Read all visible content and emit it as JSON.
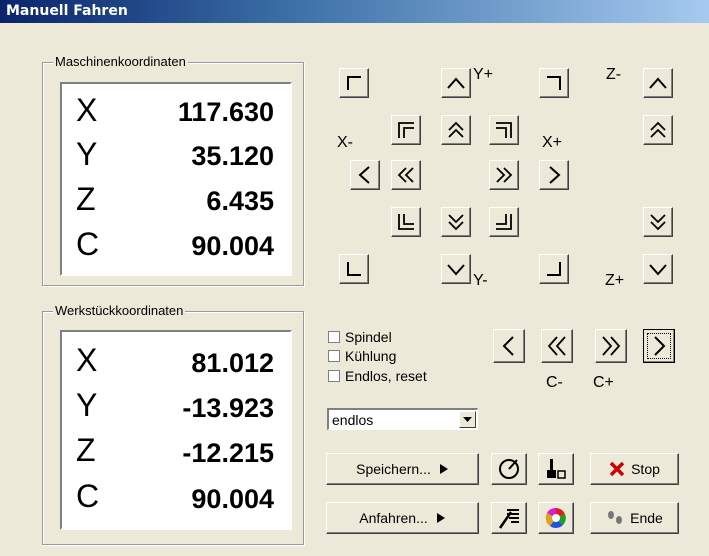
{
  "window": {
    "title": "Manuell Fahren"
  },
  "machine": {
    "legend": "Maschinenkoordinaten",
    "rows": [
      {
        "axis": "X",
        "value": "117.630"
      },
      {
        "axis": "Y",
        "value": "35.120"
      },
      {
        "axis": "Z",
        "value": "6.435"
      },
      {
        "axis": "C",
        "value": "90.004"
      }
    ]
  },
  "workpiece": {
    "legend": "Werkstückkoordinaten",
    "rows": [
      {
        "axis": "X",
        "value": "81.012"
      },
      {
        "axis": "Y",
        "value": "-13.923"
      },
      {
        "axis": "Z",
        "value": "-12.215"
      },
      {
        "axis": "C",
        "value": "90.004"
      }
    ]
  },
  "jog": {
    "y_plus": "Y+",
    "y_minus": "Y-",
    "x_minus": "X-",
    "x_plus": "X+",
    "z_minus": "Z-",
    "z_plus": "Z+",
    "c_minus": "C-",
    "c_plus": "C+"
  },
  "options": {
    "spindel": "Spindel",
    "kuehlung": "Kühlung",
    "endlos": "Endlos, reset",
    "mode_selected": "endlos"
  },
  "buttons": {
    "speichern": "Speichern...",
    "anfahren": "Anfahren...",
    "stop": "Stop",
    "ende": "Ende"
  },
  "icons": {
    "stop": "x-mark-icon",
    "ende": "footsteps-icon"
  },
  "colors": {
    "stop_red": "#cc0000",
    "title_bar": "#0a246a"
  }
}
